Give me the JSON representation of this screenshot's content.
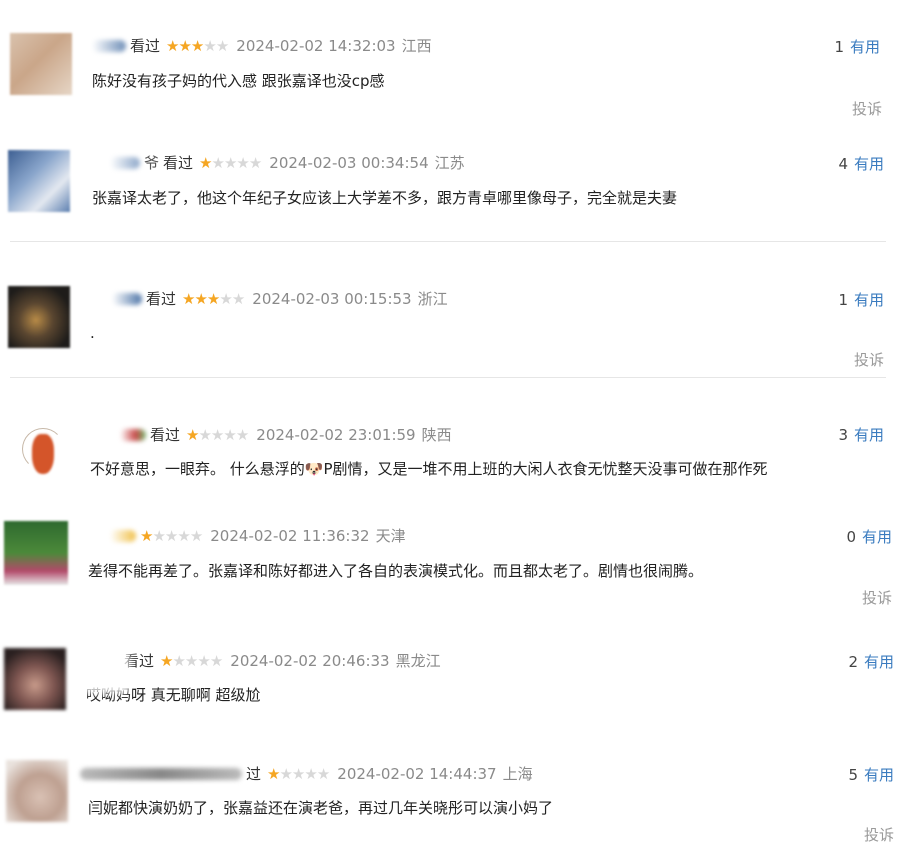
{
  "comments": [
    {
      "user_tail": "",
      "status": "看过",
      "rating": 3,
      "time": "2024-02-02 14:32:03",
      "region": "江西",
      "useful_count": "1",
      "useful_label": "有用",
      "content": "陈好没有孩子妈的代入感 跟张嘉译也没cp感",
      "report": "投诉"
    },
    {
      "user_tail": "爷",
      "status": "看过",
      "rating": 1,
      "time": "2024-02-03 00:34:54",
      "region": "江苏",
      "useful_count": "4",
      "useful_label": "有用",
      "content": "张嘉译太老了，他这个年纪子女应该上大学差不多，跟方青卓哪里像母子，完全就是夫妻",
      "report": ""
    },
    {
      "user_tail": "",
      "status": "看过",
      "rating": 3,
      "time": "2024-02-03 00:15:53",
      "region": "浙江",
      "useful_count": "1",
      "useful_label": "有用",
      "content": ".",
      "report": "投诉"
    },
    {
      "user_tail": "",
      "status": "看过",
      "rating": 1,
      "time": "2024-02-02 23:01:59",
      "region": "陕西",
      "useful_count": "3",
      "useful_label": "有用",
      "content_before": "不好意思，一眼弃。 什么悬浮的",
      "emoji": "🐶",
      "content_after": "P剧情，又是一堆不用上班的大闲人衣食无忧整天没事可做在那作死",
      "report": ""
    },
    {
      "user_tail": "",
      "status": "",
      "rating": 1,
      "time": "2024-02-02 11:36:32",
      "region": "天津",
      "useful_count": "0",
      "useful_label": "有用",
      "content": "差得不能再差了。张嘉译和陈好都进入了各自的表演模式化。而且都太老了。剧情也很闹腾。",
      "report": "投诉"
    },
    {
      "user_tail": "",
      "status": "看过",
      "rating": 1,
      "time": "2024-02-02 20:46:33",
      "region": "黑龙江",
      "useful_count": "2",
      "useful_label": "有用",
      "content": "哎呦妈呀 真无聊啊 超级尬",
      "report": ""
    },
    {
      "user_tail": "",
      "status": "过",
      "rating": 1,
      "time": "2024-02-02 14:44:37",
      "region": "上海",
      "useful_count": "5",
      "useful_label": "有用",
      "content": "闫妮都快演奶奶了，张嘉益还在演老爸，再过几年关晓彤可以演小妈了",
      "report": "投诉"
    }
  ],
  "colors": {
    "star_on": "#f5a623",
    "star_off": "#d8d8d8",
    "useful_link": "#3a7bbf",
    "meta_gray": "#8a8a8a"
  }
}
